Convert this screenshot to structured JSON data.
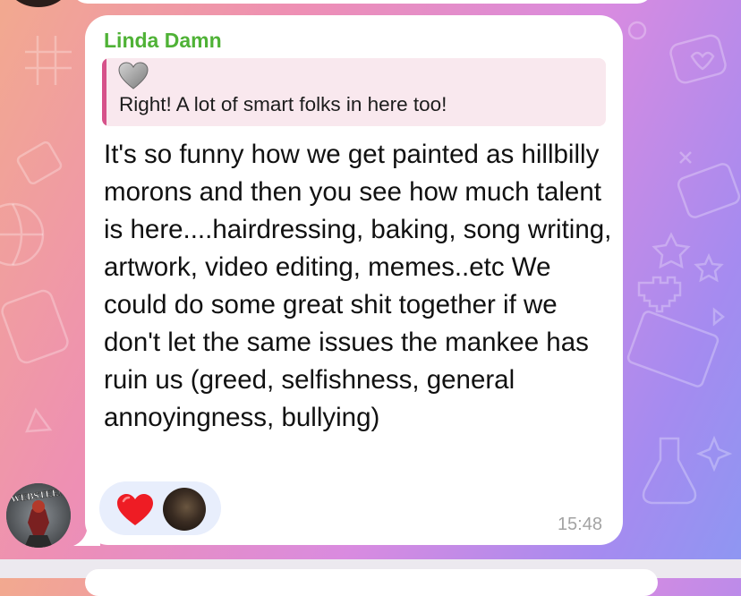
{
  "message": {
    "sender": "Linda Damn",
    "reply": {
      "emoji": "grey-heart",
      "text": "Right! A lot of smart folks in here too!"
    },
    "body": "It's so funny how we get painted as hillbilly morons and then you see how much talent is here....hairdressing, baking, song writing, artwork, video editing, memes..etc We could do some great shit together if we don't let the same issues the mankee has ruin us (greed, selfishness, general annoyingness, bullying)",
    "reactions": [
      {
        "emoji": "red-heart"
      }
    ],
    "time": "15:48"
  },
  "avatar": {
    "text": "WEBSTEEN"
  },
  "colors": {
    "sender": "#4fb236",
    "reply_bar": "#d6528a",
    "reply_bg": "#f9e8ee",
    "reaction_bg": "#e8eefc",
    "timestamp": "#a3a3a3"
  }
}
